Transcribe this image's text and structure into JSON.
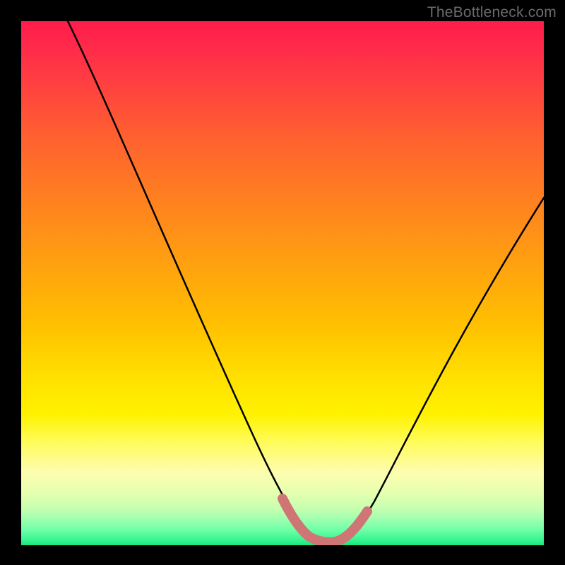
{
  "watermark": "TheBottleneck.com",
  "chart_data": {
    "type": "line",
    "title": "",
    "xlabel": "",
    "ylabel": "",
    "xlim": [
      0,
      100
    ],
    "ylim": [
      0,
      100
    ],
    "grid": false,
    "legend": false,
    "series": [
      {
        "name": "main-curve",
        "color": "#000000",
        "x": [
          9,
          15,
          20,
          25,
          30,
          35,
          40,
          45,
          48,
          50,
          53,
          56,
          59,
          61,
          63,
          66,
          70,
          75,
          80,
          85,
          90,
          95,
          100
        ],
        "y": [
          100,
          90,
          81,
          72,
          63,
          54,
          45,
          35,
          27,
          20,
          13,
          7,
          3,
          1.5,
          1.7,
          3.5,
          8,
          18,
          28,
          38,
          48,
          58,
          67
        ]
      },
      {
        "name": "bottleneck-band",
        "color": "#d17272",
        "x": [
          53,
          55,
          57,
          59,
          61,
          63,
          65
        ],
        "y": [
          12,
          6,
          3,
          1.5,
          1.8,
          3.5,
          7
        ]
      }
    ],
    "background_gradient_stops": [
      {
        "pos": 0,
        "color": "#ff1c4a"
      },
      {
        "pos": 22,
        "color": "#ff6030"
      },
      {
        "pos": 58,
        "color": "#ffc000"
      },
      {
        "pos": 80,
        "color": "#fffb55"
      },
      {
        "pos": 95,
        "color": "#a0ffb0"
      },
      {
        "pos": 100,
        "color": "#16e67c"
      }
    ]
  }
}
